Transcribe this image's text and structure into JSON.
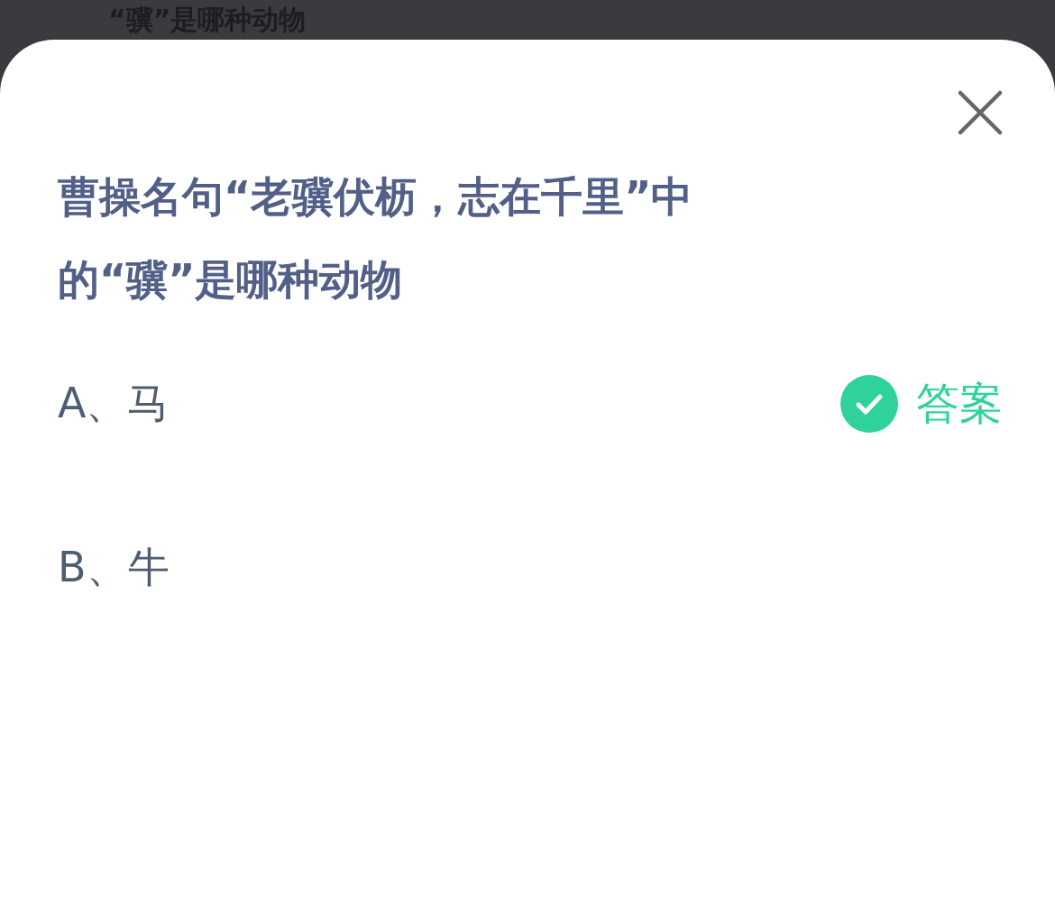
{
  "background_question": "“骥”是哪种动物",
  "question": "曹操名句“老骥伏枥，志在千里”中的“骥”是哪种动物",
  "answer_badge": "答案",
  "options": [
    {
      "label": "A、马",
      "correct": true
    },
    {
      "label": "B、牛",
      "correct": false
    }
  ]
}
